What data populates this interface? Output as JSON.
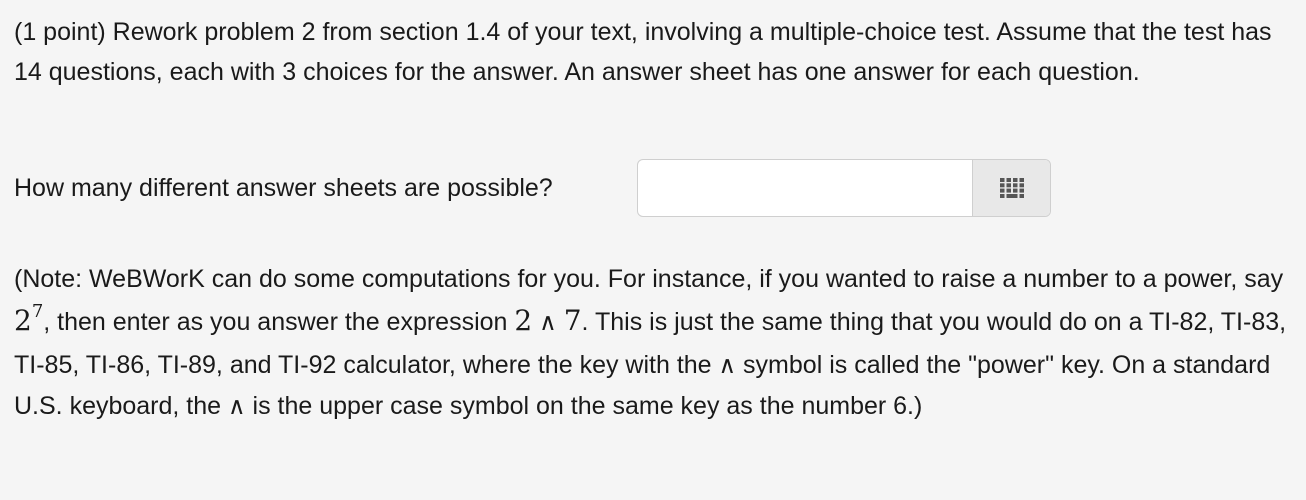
{
  "problem": {
    "intro_text": "(1 point) Rework problem 2 from section 1.4 of your text, involving a multiple-choice test. Assume that the test has 14 questions, each with 3 choices for the answer. An answer sheet has one answer for each question.",
    "question_label": "How many different answer sheets are possible?",
    "answer_value": "",
    "palette_icon": "grid-icon"
  },
  "note": {
    "part1": "(Note: WeBWorK can do some computations for you. For instance, if you wanted to raise a number to a power, say ",
    "example_base": "2",
    "example_exponent": "7",
    "part2": ", then enter as you answer the expression ",
    "expr_base": "2",
    "wedge_symbol": "∧",
    "expr_exponent": "7",
    "part3": ". This is just the same thing that you would do on a TI-82, TI-83, TI-85, TI-86, TI-89, and TI-92 calculator, where the key with the ",
    "part4": " symbol is called the \"power\" key. On a standard U.S. keyboard, the ",
    "part5": " is the upper case symbol on the same key as the number 6.)"
  }
}
